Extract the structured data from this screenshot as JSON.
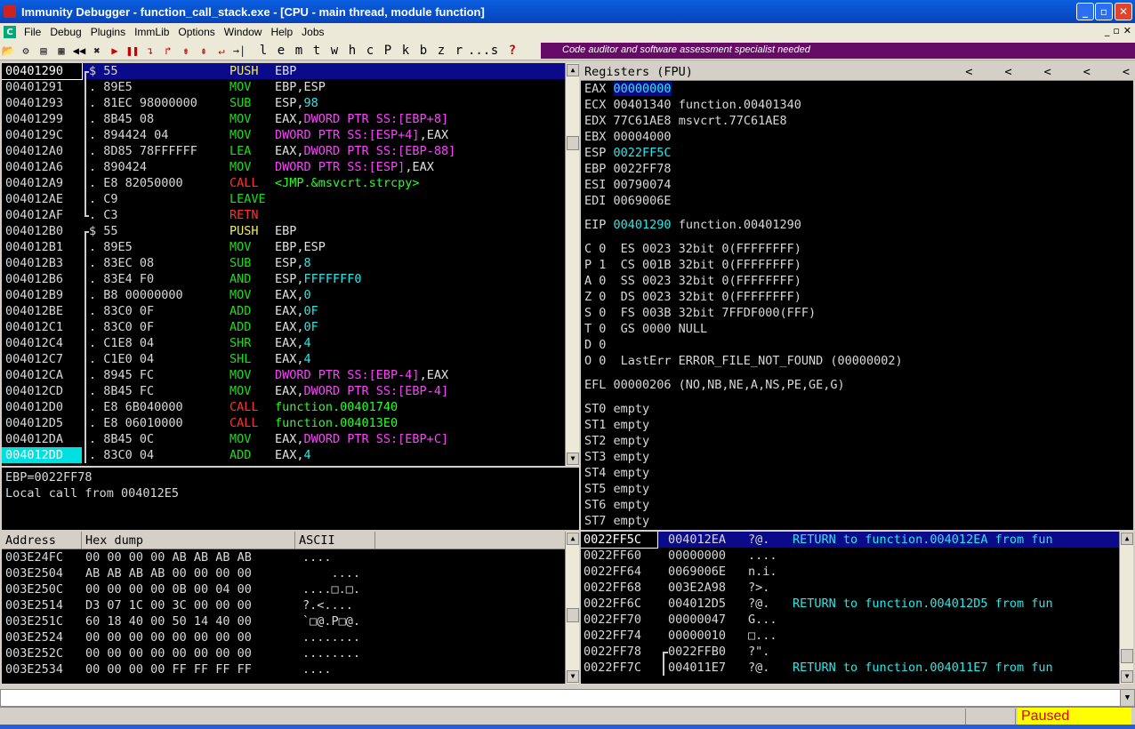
{
  "window": {
    "title": "Immunity Debugger - function_call_stack.exe - [CPU - main thread, module function]"
  },
  "menu": [
    "File",
    "Debug",
    "Plugins",
    "ImmLib",
    "Options",
    "Window",
    "Help",
    "Jobs"
  ],
  "toolbar": {
    "letters": [
      "l",
      "e",
      "m",
      "t",
      "w",
      "h",
      "c",
      "P",
      "k",
      "b",
      "z",
      "r",
      "...",
      "s",
      "?"
    ],
    "banner": "Code auditor and software assessment specialist needed"
  },
  "disasm": [
    {
      "a": "00401290",
      "h": "$ 55",
      "m": "PUSH",
      "o": [
        {
          "t": "EBP",
          "c": "op"
        }
      ],
      "k": "push",
      "s": true,
      "br": "top"
    },
    {
      "a": "00401291",
      "h": ". 89E5",
      "m": "MOV",
      "o": [
        {
          "t": "EBP,ESP",
          "c": "op"
        }
      ],
      "k": "mov",
      "br": "mid"
    },
    {
      "a": "00401293",
      "h": ". 81EC 98000000",
      "m": "SUB",
      "o": [
        {
          "t": "ESP,",
          "c": "op"
        },
        {
          "t": "98",
          "c": "num"
        }
      ],
      "k": "sub",
      "br": "mid"
    },
    {
      "a": "00401299",
      "h": ". 8B45 08",
      "m": "MOV",
      "o": [
        {
          "t": "EAX,",
          "c": "op"
        },
        {
          "t": "DWORD PTR SS:[EBP+8]",
          "c": "mem"
        }
      ],
      "k": "mov",
      "br": "mid"
    },
    {
      "a": "0040129C",
      "h": ". 894424 04",
      "m": "MOV",
      "o": [
        {
          "t": "DWORD PTR SS:[ESP+4]",
          "c": "mem"
        },
        {
          "t": ",EAX",
          "c": "op"
        }
      ],
      "k": "mov",
      "br": "mid"
    },
    {
      "a": "004012A0",
      "h": ". 8D85 78FFFFFF",
      "m": "LEA",
      "o": [
        {
          "t": "EAX,",
          "c": "op"
        },
        {
          "t": "DWORD PTR SS:[EBP-88]",
          "c": "mem"
        }
      ],
      "k": "lea",
      "br": "mid"
    },
    {
      "a": "004012A6",
      "h": ". 890424",
      "m": "MOV",
      "o": [
        {
          "t": "DWORD PTR SS:[ESP]",
          "c": "mem"
        },
        {
          "t": ",EAX",
          "c": "op"
        }
      ],
      "k": "mov",
      "br": "mid"
    },
    {
      "a": "004012A9",
      "h": ". E8 82050000",
      "m": "CALL",
      "o": [
        {
          "t": "<JMP.&msvcrt.strcpy>",
          "c": "cgt"
        }
      ],
      "k": "call",
      "br": "mid"
    },
    {
      "a": "004012AE",
      "h": ". C9",
      "m": "LEAVE",
      "o": [],
      "k": "mov",
      "br": "mid"
    },
    {
      "a": "004012AF",
      "h": ". C3",
      "m": "RETN",
      "o": [],
      "k": "retn",
      "br": "bot"
    },
    {
      "a": "004012B0",
      "h": "$ 55",
      "m": "PUSH",
      "o": [
        {
          "t": "EBP",
          "c": "op"
        }
      ],
      "k": "push",
      "br": "top"
    },
    {
      "a": "004012B1",
      "h": ". 89E5",
      "m": "MOV",
      "o": [
        {
          "t": "EBP,ESP",
          "c": "op"
        }
      ],
      "k": "mov",
      "br": "mid"
    },
    {
      "a": "004012B3",
      "h": ". 83EC 08",
      "m": "SUB",
      "o": [
        {
          "t": "ESP,",
          "c": "op"
        },
        {
          "t": "8",
          "c": "num"
        }
      ],
      "k": "sub",
      "br": "mid"
    },
    {
      "a": "004012B6",
      "h": ". 83E4 F0",
      "m": "AND",
      "o": [
        {
          "t": "ESP,",
          "c": "op"
        },
        {
          "t": "FFFFFFF0",
          "c": "num"
        }
      ],
      "k": "sub",
      "br": "mid"
    },
    {
      "a": "004012B9",
      "h": ". B8 00000000",
      "m": "MOV",
      "o": [
        {
          "t": "EAX,",
          "c": "op"
        },
        {
          "t": "0",
          "c": "num"
        }
      ],
      "k": "mov",
      "br": "mid"
    },
    {
      "a": "004012BE",
      "h": ". 83C0 0F",
      "m": "ADD",
      "o": [
        {
          "t": "EAX,",
          "c": "op"
        },
        {
          "t": "0F",
          "c": "num"
        }
      ],
      "k": "sub",
      "br": "mid"
    },
    {
      "a": "004012C1",
      "h": ". 83C0 0F",
      "m": "ADD",
      "o": [
        {
          "t": "EAX,",
          "c": "op"
        },
        {
          "t": "0F",
          "c": "num"
        }
      ],
      "k": "sub",
      "br": "mid"
    },
    {
      "a": "004012C4",
      "h": ". C1E8 04",
      "m": "SHR",
      "o": [
        {
          "t": "EAX,",
          "c": "op"
        },
        {
          "t": "4",
          "c": "num"
        }
      ],
      "k": "sub",
      "br": "mid"
    },
    {
      "a": "004012C7",
      "h": ". C1E0 04",
      "m": "SHL",
      "o": [
        {
          "t": "EAX,",
          "c": "op"
        },
        {
          "t": "4",
          "c": "num"
        }
      ],
      "k": "sub",
      "br": "mid"
    },
    {
      "a": "004012CA",
      "h": ". 8945 FC",
      "m": "MOV",
      "o": [
        {
          "t": "DWORD PTR SS:[EBP-4]",
          "c": "mem"
        },
        {
          "t": ",EAX",
          "c": "op"
        }
      ],
      "k": "mov",
      "br": "mid"
    },
    {
      "a": "004012CD",
      "h": ". 8B45 FC",
      "m": "MOV",
      "o": [
        {
          "t": "EAX,",
          "c": "op"
        },
        {
          "t": "DWORD PTR SS:[EBP-4]",
          "c": "mem"
        }
      ],
      "k": "mov",
      "br": "mid"
    },
    {
      "a": "004012D0",
      "h": ". E8 6B040000",
      "m": "CALL",
      "o": [
        {
          "t": "function.00401740",
          "c": "cgt"
        }
      ],
      "k": "call",
      "br": "mid"
    },
    {
      "a": "004012D5",
      "h": ". E8 06010000",
      "m": "CALL",
      "o": [
        {
          "t": "function.004013E0",
          "c": "cgt"
        }
      ],
      "k": "call",
      "br": "mid"
    },
    {
      "a": "004012DA",
      "h": ". 8B45 0C",
      "m": "MOV",
      "o": [
        {
          "t": "EAX,",
          "c": "op"
        },
        {
          "t": "DWORD PTR SS:[EBP+C]",
          "c": "mem"
        }
      ],
      "k": "mov",
      "br": "mid"
    },
    {
      "a": "004012DD",
      "h": ". 83C0 04",
      "m": "ADD",
      "o": [
        {
          "t": "EAX,",
          "c": "op"
        },
        {
          "t": "4",
          "c": "num"
        }
      ],
      "k": "sub",
      "br": "mid",
      "cy": true
    }
  ],
  "info": [
    "EBP=0022FF78",
    "Local call from 004012E5"
  ],
  "registers": {
    "header": "Registers (FPU)",
    "arrows": [
      "<",
      "<",
      "<",
      "<",
      "<"
    ],
    "gpr": [
      {
        "n": "EAX",
        "v": "00000000",
        "d": "",
        "hl": "sel"
      },
      {
        "n": "ECX",
        "v": "00401340",
        "d": "function.00401340"
      },
      {
        "n": "EDX",
        "v": "77C61AE8",
        "d": "msvcrt.77C61AE8"
      },
      {
        "n": "EBX",
        "v": "00004000",
        "d": ""
      },
      {
        "n": "ESP",
        "v": "0022FF5C",
        "d": "",
        "hl": "cyan"
      },
      {
        "n": "EBP",
        "v": "0022FF78",
        "d": ""
      },
      {
        "n": "ESI",
        "v": "00790074",
        "d": ""
      },
      {
        "n": "EDI",
        "v": "0069006E",
        "d": ""
      }
    ],
    "eip": {
      "n": "EIP",
      "v": "00401290",
      "d": "function.00401290"
    },
    "flags": [
      "C 0  ES 0023 32bit 0(FFFFFFFF)",
      "P 1  CS 001B 32bit 0(FFFFFFFF)",
      "A 0  SS 0023 32bit 0(FFFFFFFF)",
      "Z 0  DS 0023 32bit 0(FFFFFFFF)",
      "S 0  FS 003B 32bit 7FFDF000(FFF)",
      "T 0  GS 0000 NULL",
      "D 0",
      "O 0  LastErr ERROR_FILE_NOT_FOUND (00000002)"
    ],
    "efl": "EFL 00000206 (NO,NB,NE,A,NS,PE,GE,G)",
    "fpu": [
      "ST0 empty",
      "ST1 empty",
      "ST2 empty",
      "ST3 empty",
      "ST4 empty",
      "ST5 empty",
      "ST6 empty",
      "ST7 empty"
    ]
  },
  "dump": {
    "headers": [
      "Address",
      "Hex dump",
      "ASCII"
    ],
    "rows": [
      {
        "a": "003E24FC",
        "h": "00 00 00 00 AB AB AB AB",
        "s": "...."
      },
      {
        "a": "003E2504",
        "h": "AB AB AB AB 00 00 00 00",
        "s": "    ...."
      },
      {
        "a": "003E250C",
        "h": "00 00 00 00 0B 00 04 00",
        "s": "....□.□."
      },
      {
        "a": "003E2514",
        "h": "D3 07 1C 00 3C 00 00 00",
        "s": "?.<...."
      },
      {
        "a": "003E251C",
        "h": "60 18 40 00 50 14 40 00",
        "s": "`□@.P□@."
      },
      {
        "a": "003E2524",
        "h": "00 00 00 00 00 00 00 00",
        "s": "........"
      },
      {
        "a": "003E252C",
        "h": "00 00 00 00 00 00 00 00",
        "s": "........"
      },
      {
        "a": "003E2534",
        "h": "00 00 00 00 FF FF FF FF",
        "s": "...."
      }
    ]
  },
  "stack": [
    {
      "a": "0022FF5C",
      "v": "004012EA",
      "s": "?@.",
      "c": "RETURN to function.004012EA from fun",
      "sel": true
    },
    {
      "a": "0022FF60",
      "v": "00000000",
      "s": "....",
      "c": ""
    },
    {
      "a": "0022FF64",
      "v": "0069006E",
      "s": "n.i.",
      "c": ""
    },
    {
      "a": "0022FF68",
      "v": "003E2A98",
      "s": "?>.",
      "c": ""
    },
    {
      "a": "0022FF6C",
      "v": "004012D5",
      "s": "?@.",
      "c": "RETURN to function.004012D5 from fun"
    },
    {
      "a": "0022FF70",
      "v": "00000047",
      "s": "G...",
      "c": ""
    },
    {
      "a": "0022FF74",
      "v": "00000010",
      "s": "□...",
      "c": ""
    },
    {
      "a": "0022FF78",
      "v": "0022FFB0",
      "s": "?\".",
      "c": "",
      "br": true
    },
    {
      "a": "0022FF7C",
      "v": "004011E7",
      "s": "?@.",
      "c": "RETURN to function.004011E7 from fun"
    }
  ],
  "statusbar": {
    "state": "Paused"
  }
}
